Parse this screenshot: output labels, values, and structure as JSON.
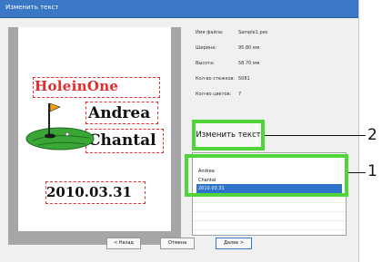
{
  "window": {
    "title": "Изменить текст"
  },
  "preview": {
    "title_text": "HoleinOne",
    "name_line_1": "Andrea",
    "name_line_2": "Chantal",
    "date_text": "2010.03.31"
  },
  "info": [
    {
      "label": "Имя файла:",
      "value": "Sample1.pes"
    },
    {
      "label": "Ширина:",
      "value": "95.80 мм"
    },
    {
      "label": "Высота:",
      "value": "58.70 мм"
    },
    {
      "label": "Кол-во стежков:",
      "value": "5081"
    },
    {
      "label": "Кол-во цветов:",
      "value": "7"
    }
  ],
  "edit_button": {
    "label": "Изменить текст"
  },
  "text_list": {
    "items": [
      "Andrea",
      "Chantal",
      "2010.03.31"
    ],
    "selected": "2010.03.31"
  },
  "callouts": [
    "2",
    "1"
  ],
  "footer": {
    "back_label": "< Назад",
    "cancel_label": "Отмена",
    "next_label": "Далее >"
  },
  "colors": {
    "highlight_green": "#4fd43a",
    "selection_blue": "#2f72c9",
    "design_red": "#e52b2b",
    "grass_green": "#3aa636"
  }
}
